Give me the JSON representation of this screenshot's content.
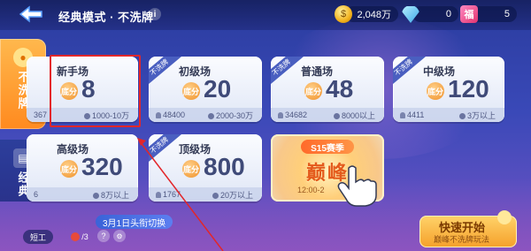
{
  "header": {
    "back_label": "",
    "title": "经典模式 · 不洗牌",
    "info": "i",
    "currency": [
      {
        "name": "gold",
        "value": "2,048万",
        "icon": "gold-coin-icon"
      },
      {
        "name": "diamond",
        "value": "0",
        "icon": "diamond-icon"
      },
      {
        "name": "ticket",
        "value": "5",
        "icon": "ticket-icon"
      }
    ]
  },
  "tabs": [
    {
      "label": "不洗牌",
      "active": true
    },
    {
      "label": "经典",
      "active": false
    }
  ],
  "rooms": [
    {
      "name": "新手场",
      "base_label": "底分",
      "score": "8",
      "players": "367",
      "range": "1000-10万",
      "ribbon": ""
    },
    {
      "name": "初级场",
      "base_label": "底分",
      "score": "20",
      "players": "48400",
      "range": "2000-30万",
      "ribbon": "不洗牌"
    },
    {
      "name": "普通场",
      "base_label": "底分",
      "score": "48",
      "players": "34682",
      "range": "8000以上",
      "ribbon": "不洗牌"
    },
    {
      "name": "中级场",
      "base_label": "底分",
      "score": "120",
      "players": "4411",
      "range": "3万以上",
      "ribbon": "不洗牌"
    },
    {
      "name": "高级场",
      "base_label": "底分",
      "score": "320",
      "players": "6",
      "range": "8万以上",
      "ribbon": ""
    },
    {
      "name": "顶级场",
      "base_label": "底分",
      "score": "800",
      "players": "1767",
      "range": "20万以上",
      "ribbon": "不洗牌"
    }
  ],
  "season": {
    "tag": "S15赛季",
    "big_text": "巅峰",
    "time": "12:00-2"
  },
  "bottom": {
    "helper": "短工",
    "task_count": "/3",
    "bubble": "3月1日头衔切换",
    "quick_title": "快速开始",
    "quick_sub": "巅峰不洗牌玩法"
  },
  "colors": {
    "highlight": "#e3262a",
    "accent_orange": "#ff8a1f",
    "card_bg": "#fbfcff"
  }
}
